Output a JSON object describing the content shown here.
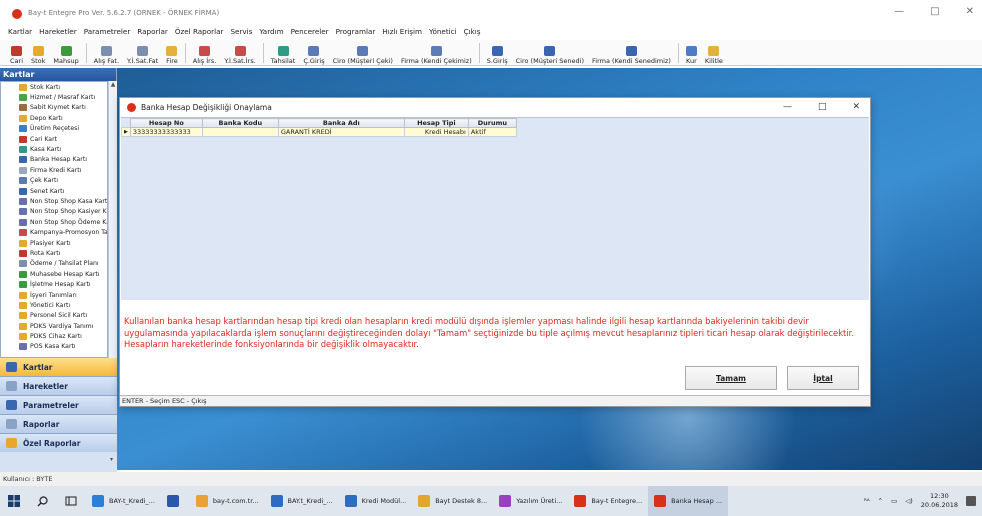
{
  "app": {
    "title": "Bay-t Entegre Pro Ver. 5.6.2.7 (ORNEK - ÖRNEK FİRMA)",
    "win_ctrls": [
      "—",
      "□",
      "✕"
    ]
  },
  "menu": [
    "Kartlar",
    "Hareketler",
    "Parametreler",
    "Raporlar",
    "Özel Raporlar",
    "Servis",
    "Yardım",
    "Pencereler",
    "Programlar",
    "Hızlı Erişim",
    "Yönetici",
    "Çıkış"
  ],
  "toolbar": [
    {
      "label": "Cari",
      "icon": "people-icon",
      "color": "#c0392b"
    },
    {
      "label": "Stok",
      "icon": "box-icon",
      "color": "#e6a92c"
    },
    {
      "label": "Mahsup",
      "icon": "arrows-icon",
      "color": "#3b9a3b"
    },
    {
      "sep": true
    },
    {
      "label": "Alış Fat.",
      "icon": "invoice-icon",
      "color": "#7d8fb0"
    },
    {
      "label": "Y.İ.Sat.Fat",
      "icon": "invoice-icon",
      "color": "#7d8fb0"
    },
    {
      "label": "Fire",
      "icon": "fire-icon",
      "color": "#e5b03d"
    },
    {
      "sep": true
    },
    {
      "label": "Alış İrs.",
      "icon": "truck-icon",
      "color": "#c84a4a"
    },
    {
      "label": "Y.İ.Sat.İrs.",
      "icon": "truck-icon",
      "color": "#c84a4a"
    },
    {
      "sep": true
    },
    {
      "label": "Tahsilat",
      "icon": "cash-icon",
      "color": "#2f9a86"
    },
    {
      "label": "Ç.Giriş",
      "icon": "cheque-icon",
      "color": "#5a7bb5"
    },
    {
      "label": "Ciro (Müşteri Çeki)",
      "icon": "cheque-icon",
      "color": "#5a7bb5"
    },
    {
      "label": "Firma (Kendi Çekimiz)",
      "icon": "cheque-icon",
      "color": "#5a7bb5"
    },
    {
      "sep": true
    },
    {
      "label": "S.Giriş",
      "icon": "note-icon",
      "color": "#3a66b0"
    },
    {
      "label": "Ciro (Müşteri Senedi)",
      "icon": "note-icon",
      "color": "#3a66b0"
    },
    {
      "label": "Firma (Kendi Senedimiz)",
      "icon": "note-icon",
      "color": "#3a66b0"
    },
    {
      "sep": true
    },
    {
      "label": "Kur",
      "icon": "currency-icon",
      "color": "#4d7cc4"
    },
    {
      "label": "Kilitle",
      "icon": "key-icon",
      "color": "#e2b33a"
    }
  ],
  "sidebar": {
    "title": "Kartlar",
    "items": [
      {
        "label": "Stok Kartı",
        "color": "#e6a92c"
      },
      {
        "label": "Hizmet / Masraf Kartı",
        "color": "#4aa24a"
      },
      {
        "label": "Sabit Kıymet Kartı",
        "color": "#9a6b3c"
      },
      {
        "label": "Depo Kartı",
        "color": "#e6a92c"
      },
      {
        "label": "Üretim Reçetesi",
        "color": "#3b7fc4"
      },
      {
        "label": "Cari Kart",
        "color": "#c0392b"
      },
      {
        "label": "Kasa Kartı",
        "color": "#2f9a86"
      },
      {
        "label": "Banka Hesap Kartı",
        "color": "#3a66b0"
      },
      {
        "label": "Firma Kredi Kartı",
        "color": "#9aa8bb"
      },
      {
        "label": "Çek Kartı",
        "color": "#5a7bb5"
      },
      {
        "label": "Senet Kartı",
        "color": "#3a66b0"
      },
      {
        "label": "Non Stop Shop Kasa Kartı",
        "color": "#6a6fb0"
      },
      {
        "label": "Non Stop Shop Kasiyer Kartı",
        "color": "#6a6fb0"
      },
      {
        "label": "Non Stop Shop Ödeme Kartı",
        "color": "#6a6fb0"
      },
      {
        "label": "Kampanya-Promosyon Tanımları",
        "color": "#c84a4a"
      },
      {
        "label": "Plasiyer Kartı",
        "color": "#e6a92c"
      },
      {
        "label": "Rota Kartı",
        "color": "#c0392b"
      },
      {
        "label": "Ödeme / Tahsilat Planı",
        "color": "#7d8fb0"
      },
      {
        "label": "Muhasebe Hesap Kartı",
        "color": "#3b9a3b"
      },
      {
        "label": "İşletme Hesap Kartı",
        "color": "#3b9a3b"
      },
      {
        "label": "İşyeri Tanımları",
        "color": "#e6a92c"
      },
      {
        "label": "Yönetici Kartı",
        "color": "#e6a92c"
      },
      {
        "label": "Personel Sicil Kartı",
        "color": "#e6a92c"
      },
      {
        "label": "PDKS Vardiya Tanımı",
        "color": "#e6a92c"
      },
      {
        "label": "PDKS Cihaz Kartı",
        "color": "#e6a92c"
      },
      {
        "label": "POS Kasa Kartı",
        "color": "#6a6fb0"
      }
    ],
    "nav": [
      {
        "label": "Kartlar",
        "active": true,
        "color": "#3a66b0"
      },
      {
        "label": "Hareketler",
        "active": false,
        "color": "#8aa2c8"
      },
      {
        "label": "Parametreler",
        "active": false,
        "color": "#3a66b0"
      },
      {
        "label": "Raporlar",
        "active": false,
        "color": "#8aa2c8"
      },
      {
        "label": "Özel Raporlar",
        "active": false,
        "color": "#e6a92c"
      },
      {
        "label": "Servis",
        "active": false,
        "color": "#3b9a3b"
      }
    ]
  },
  "statusbar": {
    "text": "Kullanıcı : BYTE"
  },
  "dialog": {
    "title": "Banka Hesap Değişikliği Onaylama",
    "columns": [
      "Hesap No",
      "Banka Kodu",
      "Banka Adı",
      "Hesap Tipi",
      "Durumu"
    ],
    "rows": [
      [
        "33333333333333",
        "",
        "GARANTİ KREDİ",
        "Kredi Hesabı",
        "Aktif"
      ]
    ],
    "message": "Kullanılan banka hesap kartlarından hesap tipi kredi olan hesapların kredi modülü dışında işlemler yapması halinde ilgili hesap kartlarında bakiyelerinin takibi devir uygulamasında yapılacaklarda işlem sonuçlarını değiştireceğinden dolayı \"Tamam\" seçtiğinizde bu tiple açılmış mevcut hesaplarınız tipleri ticari hesap olarak değiştirilecektir. Hesapların hareketlerinde fonksiyonlarında bir değişiklik olmayacaktır.",
    "ok_label": "Tamam",
    "cancel_label": "İptal",
    "status": "ENTER - Seçim  ESC - Çıkış",
    "ctrls": [
      "—",
      "□",
      "✕"
    ]
  },
  "taskbar": {
    "tasks": [
      {
        "label": "BAY-t_Kredi_...",
        "color": "#2b7fd6",
        "active": false
      },
      {
        "label": "",
        "color": "#2a58a8",
        "active": false
      },
      {
        "label": "bay-t.com.tr...",
        "color": "#e9a234",
        "active": false
      },
      {
        "label": "BAY.t_Kredi_...",
        "color": "#2f6cc0",
        "active": false
      },
      {
        "label": "Kredi Modül...",
        "color": "#2f6cc0",
        "active": false
      },
      {
        "label": "Bayt Destek 8...",
        "color": "#e2a62e",
        "active": false
      },
      {
        "label": "Yazılım Üreti...",
        "color": "#9b3fc0",
        "active": false
      },
      {
        "label": "Bay-t Entegre...",
        "color": "#d9301c",
        "active": false
      },
      {
        "label": "Banka Hesap ...",
        "color": "#d9301c",
        "active": true
      }
    ],
    "time": "12:30",
    "date": "20.06.2018"
  }
}
